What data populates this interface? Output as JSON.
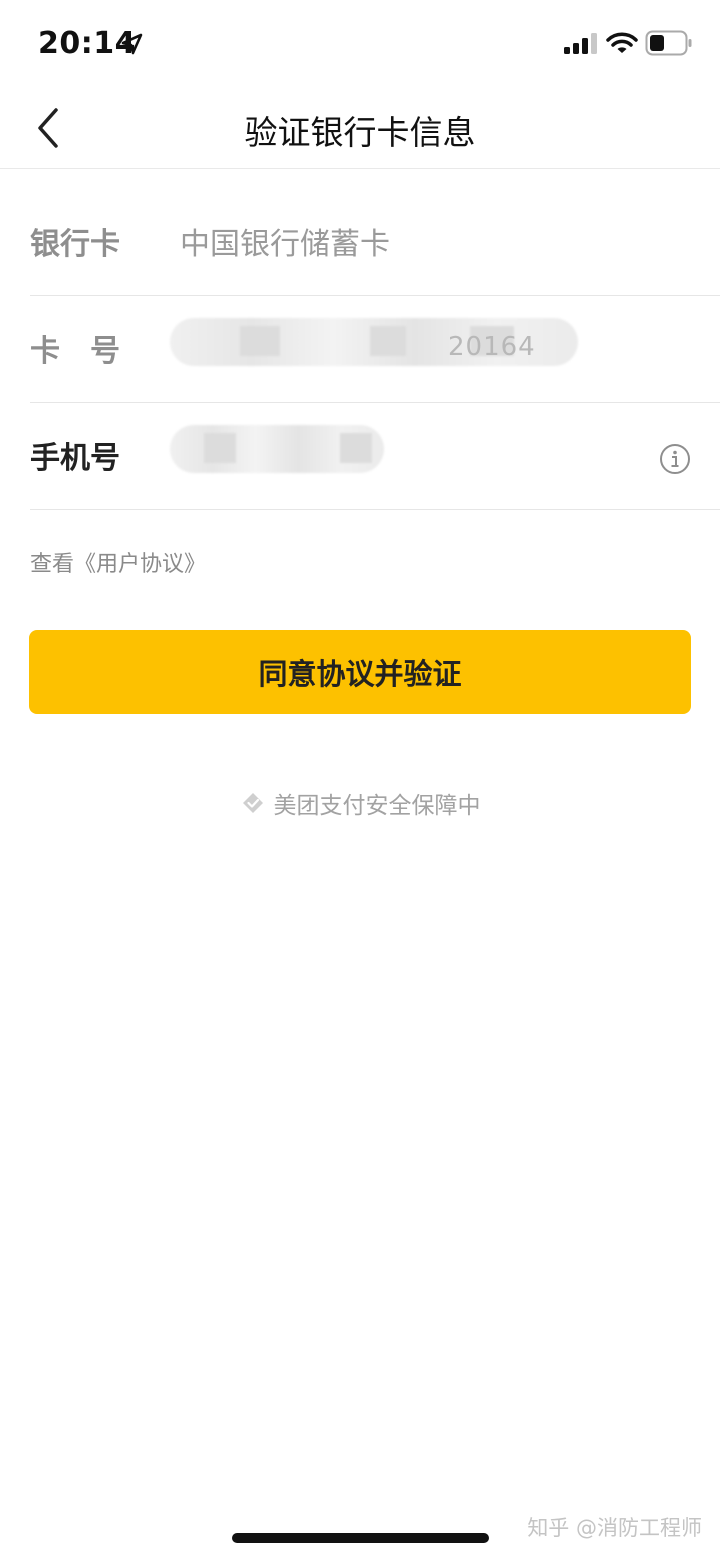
{
  "status_bar": {
    "time": "20:14",
    "icons": [
      "location-arrow-icon",
      "signal-icon",
      "wifi-icon",
      "battery-icon"
    ]
  },
  "nav": {
    "title": "验证银行卡信息",
    "back_icon": "back-chevron-icon"
  },
  "form": {
    "bank_card": {
      "label": "银行卡",
      "value": "中国银行储蓄卡"
    },
    "card_number": {
      "label": "卡　号",
      "value_tail": "20164"
    },
    "phone": {
      "label": "手机号",
      "info_icon": "info-icon"
    }
  },
  "agreement_link": "查看《用户协议》",
  "agree_button": "同意协议并验证",
  "secure_note": {
    "icon": "shield-icon",
    "text": "美团支付安全保障中"
  },
  "watermark": "知乎 @消防工程师",
  "colors": {
    "accent": "#fdc100",
    "label_gray": "#8e8e8e",
    "divider": "#e6e6e6"
  }
}
